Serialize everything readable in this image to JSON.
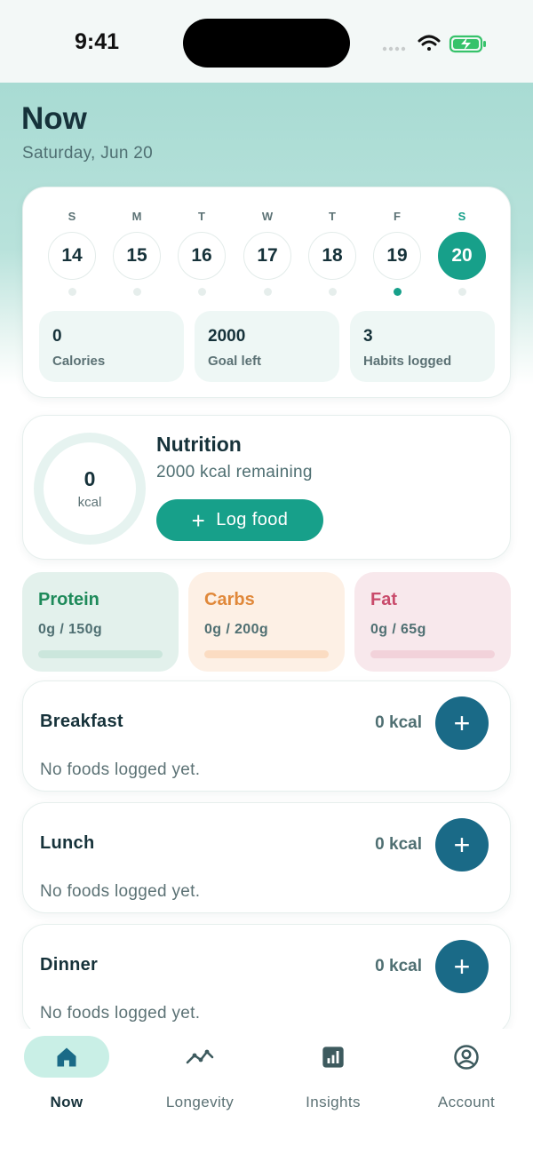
{
  "status": {
    "time": "9:41"
  },
  "header": {
    "title": "Now",
    "date": "Saturday, Jun 20"
  },
  "week": {
    "days": [
      {
        "letter": "S",
        "num": "14",
        "selected": false,
        "logged": false
      },
      {
        "letter": "M",
        "num": "15",
        "selected": false,
        "logged": false
      },
      {
        "letter": "T",
        "num": "16",
        "selected": false,
        "logged": false
      },
      {
        "letter": "W",
        "num": "17",
        "selected": false,
        "logged": false
      },
      {
        "letter": "T",
        "num": "18",
        "selected": false,
        "logged": false
      },
      {
        "letter": "F",
        "num": "19",
        "selected": false,
        "logged": true
      },
      {
        "letter": "S",
        "num": "20",
        "selected": true,
        "logged": false
      }
    ],
    "stats": [
      {
        "value": "0",
        "label": "Calories"
      },
      {
        "value": "2000",
        "label": "Goal left"
      },
      {
        "value": "3",
        "label": "Habits logged"
      }
    ]
  },
  "nutrition": {
    "title": "Nutrition",
    "ring_value": "0",
    "ring_unit": "kcal",
    "remaining": "2000 kcal remaining",
    "log_button": "Log food"
  },
  "macros": [
    {
      "name": "Protein",
      "amount": "0g / 150g",
      "progress": 0,
      "color": "#1e8a5a",
      "bg": "#e3f1ec",
      "track": "#cbe6dc"
    },
    {
      "name": "Carbs",
      "amount": "0g / 200g",
      "progress": 0,
      "color": "#e0883a",
      "bg": "#fdf0e5",
      "track": "#fbdcc2"
    },
    {
      "name": "Fat",
      "amount": "0g / 65g",
      "progress": 0,
      "color": "#c94a6b",
      "bg": "#f8e8ec",
      "track": "#f2d2da"
    }
  ],
  "meals": [
    {
      "name": "Breakfast",
      "kcal": "0 kcal",
      "empty": "No foods logged yet."
    },
    {
      "name": "Lunch",
      "kcal": "0 kcal",
      "empty": "No foods logged yet."
    },
    {
      "name": "Dinner",
      "kcal": "0 kcal",
      "empty": "No foods logged yet."
    }
  ],
  "tabs": [
    {
      "label": "Now",
      "icon": "home-icon",
      "active": true
    },
    {
      "label": "Longevity",
      "icon": "trend-icon",
      "active": false
    },
    {
      "label": "Insights",
      "icon": "chart-icon",
      "active": false
    },
    {
      "label": "Account",
      "icon": "account-icon",
      "active": false
    }
  ],
  "colors": {
    "accent": "#17a08a",
    "meal_button": "#1a6a87",
    "text": "#16323a"
  }
}
